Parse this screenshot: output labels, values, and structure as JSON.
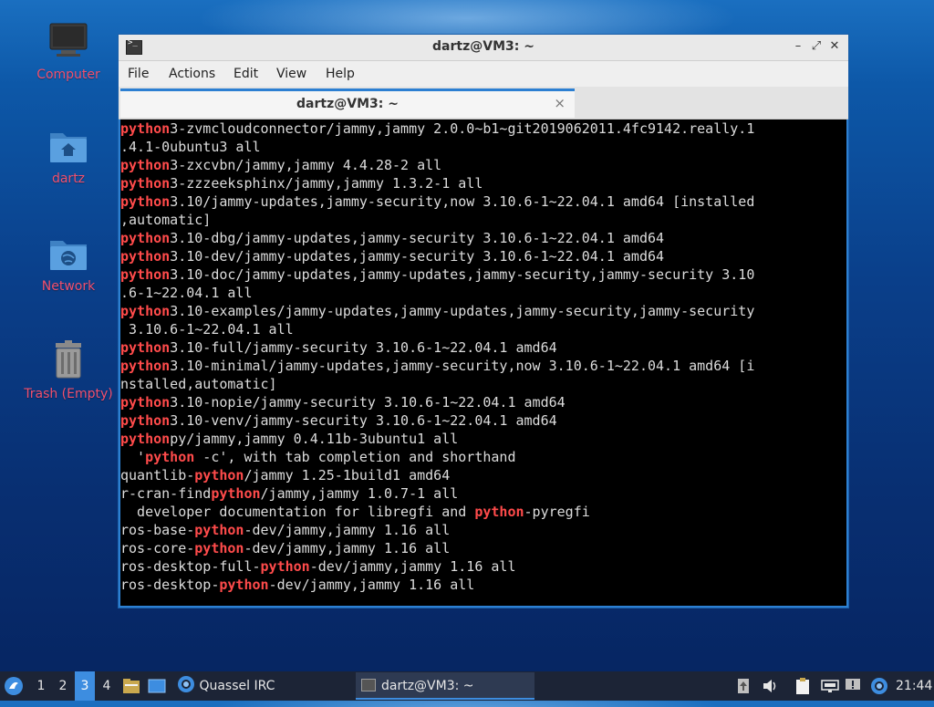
{
  "desktop": {
    "icons": [
      {
        "label": "Computer"
      },
      {
        "label": "dartz"
      },
      {
        "label": "Network"
      },
      {
        "label": "Trash (Empty)"
      }
    ]
  },
  "window": {
    "title": "dartz@VM3: ~",
    "menu": [
      "File",
      "Actions",
      "Edit",
      "View",
      "Help"
    ],
    "tab_title": "dartz@VM3: ~",
    "tab_close": "×"
  },
  "terminal": {
    "highlight_color": "#ff4b4b",
    "lines": [
      [
        {
          "t": "python",
          "h": true
        },
        {
          "t": "3-zvmcloudconnector/jammy,jammy 2.0.0~b1~git2019062011.4fc9142.really.1"
        }
      ],
      [
        {
          "t": ".4.1-0ubuntu3 all"
        }
      ],
      [
        {
          "t": "python",
          "h": true
        },
        {
          "t": "3-zxcvbn/jammy,jammy 4.4.28-2 all"
        }
      ],
      [
        {
          "t": "python",
          "h": true
        },
        {
          "t": "3-zzzeeksphinx/jammy,jammy 1.3.2-1 all"
        }
      ],
      [
        {
          "t": "python",
          "h": true
        },
        {
          "t": "3.10/jammy-updates,jammy-security,now 3.10.6-1~22.04.1 amd64 [installed"
        }
      ],
      [
        {
          "t": ",automatic]"
        }
      ],
      [
        {
          "t": "python",
          "h": true
        },
        {
          "t": "3.10-dbg/jammy-updates,jammy-security 3.10.6-1~22.04.1 amd64"
        }
      ],
      [
        {
          "t": "python",
          "h": true
        },
        {
          "t": "3.10-dev/jammy-updates,jammy-security 3.10.6-1~22.04.1 amd64"
        }
      ],
      [
        {
          "t": "python",
          "h": true
        },
        {
          "t": "3.10-doc/jammy-updates,jammy-updates,jammy-security,jammy-security 3.10"
        }
      ],
      [
        {
          "t": ".6-1~22.04.1 all"
        }
      ],
      [
        {
          "t": "python",
          "h": true
        },
        {
          "t": "3.10-examples/jammy-updates,jammy-updates,jammy-security,jammy-security"
        }
      ],
      [
        {
          "t": " 3.10.6-1~22.04.1 all"
        }
      ],
      [
        {
          "t": "python",
          "h": true
        },
        {
          "t": "3.10-full/jammy-security 3.10.6-1~22.04.1 amd64"
        }
      ],
      [
        {
          "t": "python",
          "h": true
        },
        {
          "t": "3.10-minimal/jammy-updates,jammy-security,now 3.10.6-1~22.04.1 amd64 [i"
        }
      ],
      [
        {
          "t": "nstalled,automatic]"
        }
      ],
      [
        {
          "t": "python",
          "h": true
        },
        {
          "t": "3.10-nopie/jammy-security 3.10.6-1~22.04.1 amd64"
        }
      ],
      [
        {
          "t": "python",
          "h": true
        },
        {
          "t": "3.10-venv/jammy-security 3.10.6-1~22.04.1 amd64"
        }
      ],
      [
        {
          "t": "python",
          "h": true
        },
        {
          "t": "py/jammy,jammy 0.4.11b-3ubuntu1 all"
        }
      ],
      [
        {
          "t": "  '"
        },
        {
          "t": "python",
          "h": true
        },
        {
          "t": " -c', with tab completion and shorthand"
        }
      ],
      [
        {
          "t": "quantlib-"
        },
        {
          "t": "python",
          "h": true
        },
        {
          "t": "/jammy 1.25-1build1 amd64"
        }
      ],
      [
        {
          "t": "r-cran-find"
        },
        {
          "t": "python",
          "h": true
        },
        {
          "t": "/jammy,jammy 1.0.7-1 all"
        }
      ],
      [
        {
          "t": "  developer documentation for libregfi and "
        },
        {
          "t": "python",
          "h": true
        },
        {
          "t": "-pyregfi"
        }
      ],
      [
        {
          "t": "ros-base-"
        },
        {
          "t": "python",
          "h": true
        },
        {
          "t": "-dev/jammy,jammy 1.16 all"
        }
      ],
      [
        {
          "t": "ros-core-"
        },
        {
          "t": "python",
          "h": true
        },
        {
          "t": "-dev/jammy,jammy 1.16 all"
        }
      ],
      [
        {
          "t": "ros-desktop-full-"
        },
        {
          "t": "python",
          "h": true
        },
        {
          "t": "-dev/jammy,jammy 1.16 all"
        }
      ],
      [
        {
          "t": "ros-desktop-"
        },
        {
          "t": "python",
          "h": true
        },
        {
          "t": "-dev/jammy,jammy 1.16 all"
        }
      ]
    ]
  },
  "taskbar": {
    "workspaces": [
      "1",
      "2",
      "3",
      "4"
    ],
    "active_workspace": "3",
    "quassel_label": "Quassel IRC",
    "terminal_task_label": "dartz@VM3: ~",
    "clock": "21:44"
  }
}
